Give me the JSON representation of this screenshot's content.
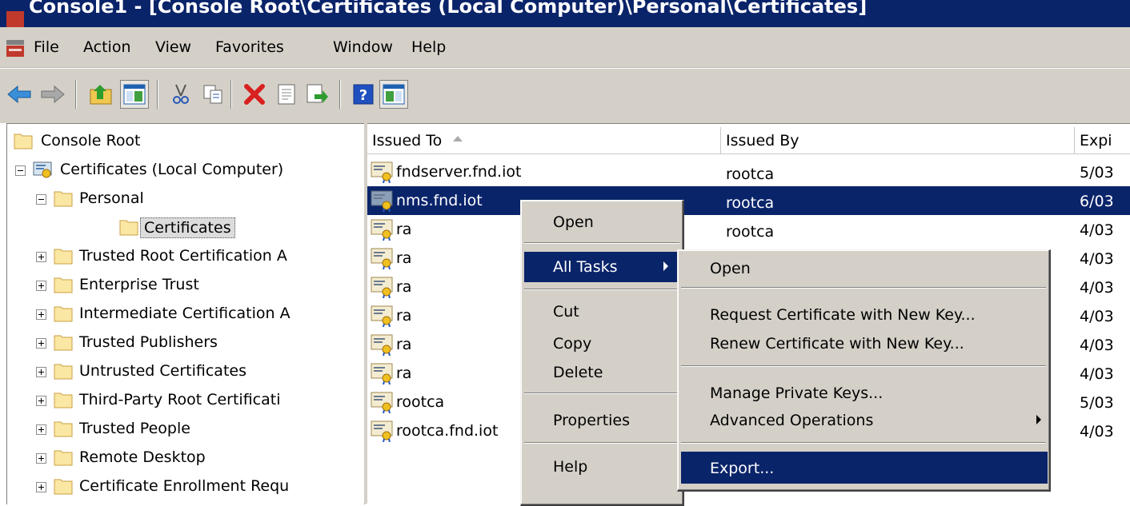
{
  "window": {
    "title": "Console1 - [Console Root\\Certificates (Local Computer)\\Personal\\Certificates]"
  },
  "menubar": {
    "items": [
      "File",
      "Action",
      "View",
      "Favorites",
      "Window",
      "Help"
    ]
  },
  "toolbar": {
    "icons": [
      "back-arrow-icon",
      "forward-arrow-icon",
      "up-folder-icon",
      "show-hide-tree-icon",
      "cut-icon",
      "copy-icon",
      "delete-icon",
      "properties-icon",
      "export-list-icon",
      "help-icon",
      "show-hide-action-pane-icon"
    ]
  },
  "tree": {
    "root": "Console Root",
    "certificates": "Certificates (Local Computer)",
    "personal": "Personal",
    "personal_certificates": "Certificates",
    "stores": [
      "Trusted Root Certification A",
      "Enterprise Trust",
      "Intermediate Certification A",
      "Trusted Publishers",
      "Untrusted Certificates",
      "Third-Party Root Certificati",
      "Trusted People",
      "Remote Desktop",
      "Certificate Enrollment Requ"
    ]
  },
  "list": {
    "columns": [
      "Issued To",
      "Issued By",
      "Expi"
    ],
    "rows": [
      {
        "issued_to": "fndserver.fnd.iot",
        "issued_by": "rootca",
        "expires": "5/03"
      },
      {
        "issued_to": "nms.fnd.iot",
        "issued_by": "rootca",
        "expires": "6/03"
      },
      {
        "issued_to": "ra",
        "issued_by": "rootca",
        "expires": "4/03"
      },
      {
        "issued_to": "ra",
        "issued_by": "",
        "expires": "4/03"
      },
      {
        "issued_to": "ra",
        "issued_by": "",
        "expires": "4/03"
      },
      {
        "issued_to": "ra",
        "issued_by": "",
        "expires": "4/03"
      },
      {
        "issued_to": "ra",
        "issued_by": "",
        "expires": "4/03"
      },
      {
        "issued_to": "ra",
        "issued_by": "",
        "expires": "4/03"
      },
      {
        "issued_to": "rootca",
        "issued_by": "",
        "expires": "5/03"
      },
      {
        "issued_to": "rootca.fnd.iot",
        "issued_by": "",
        "expires": "4/03"
      }
    ]
  },
  "context_menu": {
    "open": "Open",
    "all_tasks": "All Tasks",
    "cut": "Cut",
    "copy": "Copy",
    "delete": "Delete",
    "properties": "Properties",
    "help": "Help"
  },
  "submenu": {
    "open": "Open",
    "request_new_key": "Request Certificate with New Key...",
    "renew_new_key": "Renew Certificate with New Key...",
    "manage_keys": "Manage Private Keys...",
    "advanced": "Advanced Operations",
    "export": "Export..."
  },
  "colors": {
    "selection": "#0a246a",
    "chrome": "#d4d0c8"
  }
}
